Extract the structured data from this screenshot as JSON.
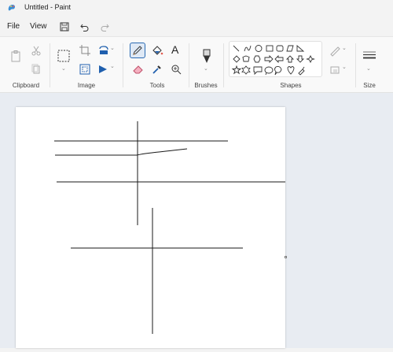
{
  "window": {
    "title": "Untitled - Paint"
  },
  "menu": {
    "file": "File",
    "view": "View"
  },
  "ribbon": {
    "groups": {
      "clipboard": "Clipboard",
      "image": "Image",
      "tools": "Tools",
      "brushes": "Brushes",
      "shapes": "Shapes",
      "size": "Size"
    }
  },
  "canvas": {
    "drawing": "hand-drawn black lines on white canvas",
    "active_tool": "pencil-icon"
  },
  "colors": {
    "accent": "#2a6ab3",
    "canvas_bg": "#ffffff",
    "workspace_bg": "#e8ecf2"
  }
}
